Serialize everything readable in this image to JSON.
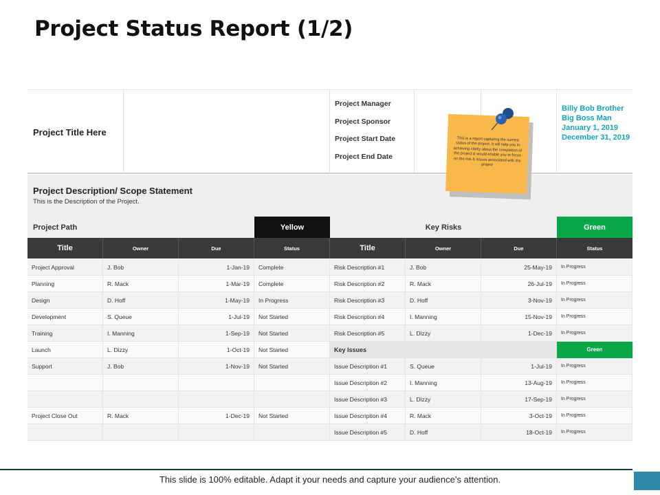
{
  "title": "Project Status Report (1/2)",
  "header": {
    "project_title": "Project Title Here",
    "labels": [
      "Project Manager",
      "Project Sponsor",
      "Project Start Date",
      "Project End Date"
    ],
    "values": [
      "Billy Bob Brother",
      "Big Boss Man",
      "January 1, 2019",
      "December 31, 2019"
    ]
  },
  "description": {
    "title": "Project Description/ Scope Statement",
    "text": "This is the Description of the Project."
  },
  "path": {
    "label": "Project Path",
    "status": "Yellow",
    "risks_label": "Key Risks",
    "risks_status": "Green"
  },
  "columns": {
    "title": "Title",
    "owner": "Owner",
    "due": "Due",
    "status": "Status"
  },
  "tasks": [
    {
      "title": "Project Approval",
      "owner": "J. Bob",
      "due": "1-Jan-19",
      "status": "Complete"
    },
    {
      "title": "Planning",
      "owner": "R. Mack",
      "due": "1-Mar-19",
      "status": "Complete"
    },
    {
      "title": "Design",
      "owner": "D. Hoff",
      "due": "1-May-19",
      "status": "In Progress"
    },
    {
      "title": "Development",
      "owner": "S. Queue",
      "due": "1-Jul-19",
      "status": "Not Started"
    },
    {
      "title": "Training",
      "owner": "I. Manning",
      "due": "1-Sep-19",
      "status": "Not Started"
    },
    {
      "title": "Launch",
      "owner": "L. Dizzy",
      "due": "1-Oct-19",
      "status": "Not Started"
    },
    {
      "title": "Support",
      "owner": "J. Bob",
      "due": "1-Nov-19",
      "status": "Not Started"
    },
    {
      "title": "",
      "owner": "",
      "due": "",
      "status": ""
    },
    {
      "title": "",
      "owner": "",
      "due": "",
      "status": ""
    },
    {
      "title": "Project Close Out",
      "owner": "R. Mack",
      "due": "1-Dec-19",
      "status": "Not Started"
    },
    {
      "title": "",
      "owner": "",
      "due": "",
      "status": ""
    }
  ],
  "risks": [
    {
      "title": "Risk Description #1",
      "owner": "J. Bob",
      "due": "25-May-19",
      "status": "In Progress"
    },
    {
      "title": "Risk Description #2",
      "owner": "R. Mack",
      "due": "26-Jul-19",
      "status": "In Progress"
    },
    {
      "title": "Risk Description #3",
      "owner": "D. Hoff",
      "due": "3-Nov-19",
      "status": "In Progress"
    },
    {
      "title": "Risk Description #4",
      "owner": "I. Manning",
      "due": "15-Nov-19",
      "status": "In Progress"
    },
    {
      "title": "Risk Description #5",
      "owner": "L. Dizzy",
      "due": "1-Dec-19",
      "status": "In Progress"
    }
  ],
  "issues_header": {
    "label": "Key Issues",
    "status": "Green"
  },
  "issues": [
    {
      "title": "Issue Description #1",
      "owner": "S. Queue",
      "due": "1-Jul-19",
      "status": "In Progress"
    },
    {
      "title": "Issue Description #2",
      "owner": "I. Manning",
      "due": "13-Aug-19",
      "status": "In Progress"
    },
    {
      "title": "Issue Description #3",
      "owner": "L. Dizzy",
      "due": "17-Sep-19",
      "status": "In Progress"
    },
    {
      "title": "Issue Description #4",
      "owner": "R. Mack",
      "due": "3-Oct-19",
      "status": "In Progress"
    },
    {
      "title": "Issue Description #5",
      "owner": "D. Hoff",
      "due": "18-Oct-19",
      "status": "In Progress"
    }
  ],
  "sticky_note": "This is a report capturing the current status of the project. It will help you in achieving clarity about the completion of the project & would enable you to focus on the risk & issues associated with the project",
  "footer": "This slide is 100% editable. Adapt it your needs and capture your audience’s attention.",
  "colors": {
    "accent": "#13a6b8",
    "green": "#0aa64a",
    "dark": "#3a3a3a",
    "note": "#f9b84a"
  }
}
